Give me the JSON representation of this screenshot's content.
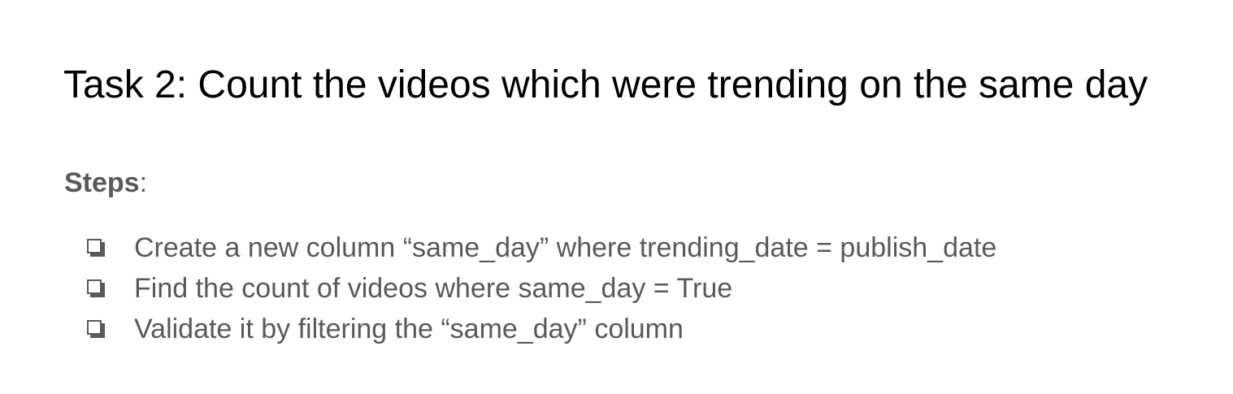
{
  "title": "Task 2: Count the videos which were trending on the same day",
  "steps": {
    "heading": "Steps",
    "heading_suffix": ":",
    "items": [
      {
        "text": "Create a new column “same_day” where trending_date = publish_date",
        "icon": "checkbox-icon"
      },
      {
        "text": "Find the count of videos where same_day = True",
        "icon": "checkbox-icon"
      },
      {
        "text": "Validate it by filtering the “same_day” column",
        "icon": "checkbox-icon"
      }
    ]
  },
  "colors": {
    "title": "#000000",
    "body": "#595959",
    "background": "#ffffff"
  }
}
